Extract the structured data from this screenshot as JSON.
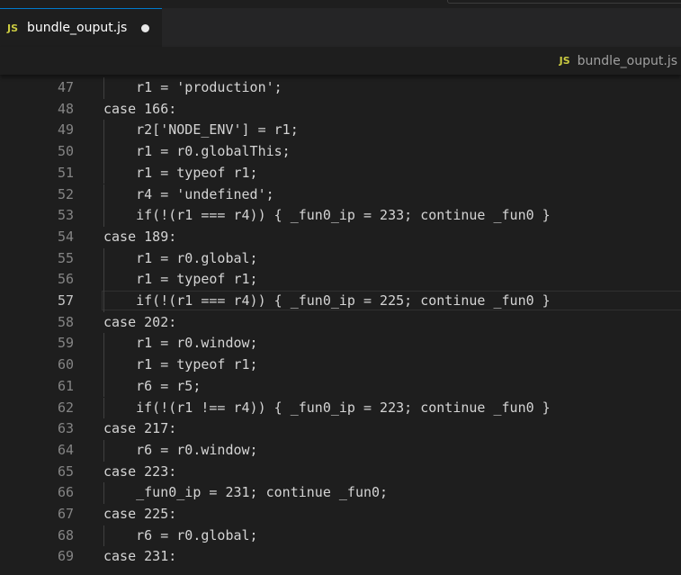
{
  "tab": {
    "icon": "JS",
    "label": "bundle_ouput.js",
    "modified": true
  },
  "breadcrumb": {
    "icon": "JS",
    "label": "bundle_ouput.js"
  },
  "editor": {
    "current_line": 57,
    "lines": [
      {
        "num": "47",
        "text": "    r1 = 'production';"
      },
      {
        "num": "48",
        "text": "case 166:"
      },
      {
        "num": "49",
        "text": "    r2['NODE_ENV'] = r1;"
      },
      {
        "num": "50",
        "text": "    r1 = r0.globalThis;"
      },
      {
        "num": "51",
        "text": "    r1 = typeof r1;"
      },
      {
        "num": "52",
        "text": "    r4 = 'undefined';"
      },
      {
        "num": "53",
        "text": "    if(!(r1 === r4)) { _fun0_ip = 233; continue _fun0 }"
      },
      {
        "num": "54",
        "text": "case 189:"
      },
      {
        "num": "55",
        "text": "    r1 = r0.global;"
      },
      {
        "num": "56",
        "text": "    r1 = typeof r1;"
      },
      {
        "num": "57",
        "text": "    if(!(r1 === r4)) { _fun0_ip = 225; continue _fun0 }"
      },
      {
        "num": "58",
        "text": "case 202:"
      },
      {
        "num": "59",
        "text": "    r1 = r0.window;"
      },
      {
        "num": "60",
        "text": "    r1 = typeof r1;"
      },
      {
        "num": "61",
        "text": "    r6 = r5;"
      },
      {
        "num": "62",
        "text": "    if(!(r1 !== r4)) { _fun0_ip = 223; continue _fun0 }"
      },
      {
        "num": "63",
        "text": "case 217:"
      },
      {
        "num": "64",
        "text": "    r6 = r0.window;"
      },
      {
        "num": "65",
        "text": "case 223:"
      },
      {
        "num": "66",
        "text": "    _fun0_ip = 231; continue _fun0;"
      },
      {
        "num": "67",
        "text": "case 225:"
      },
      {
        "num": "68",
        "text": "    r6 = r0.global;"
      },
      {
        "num": "69",
        "text": "case 231:"
      }
    ]
  }
}
